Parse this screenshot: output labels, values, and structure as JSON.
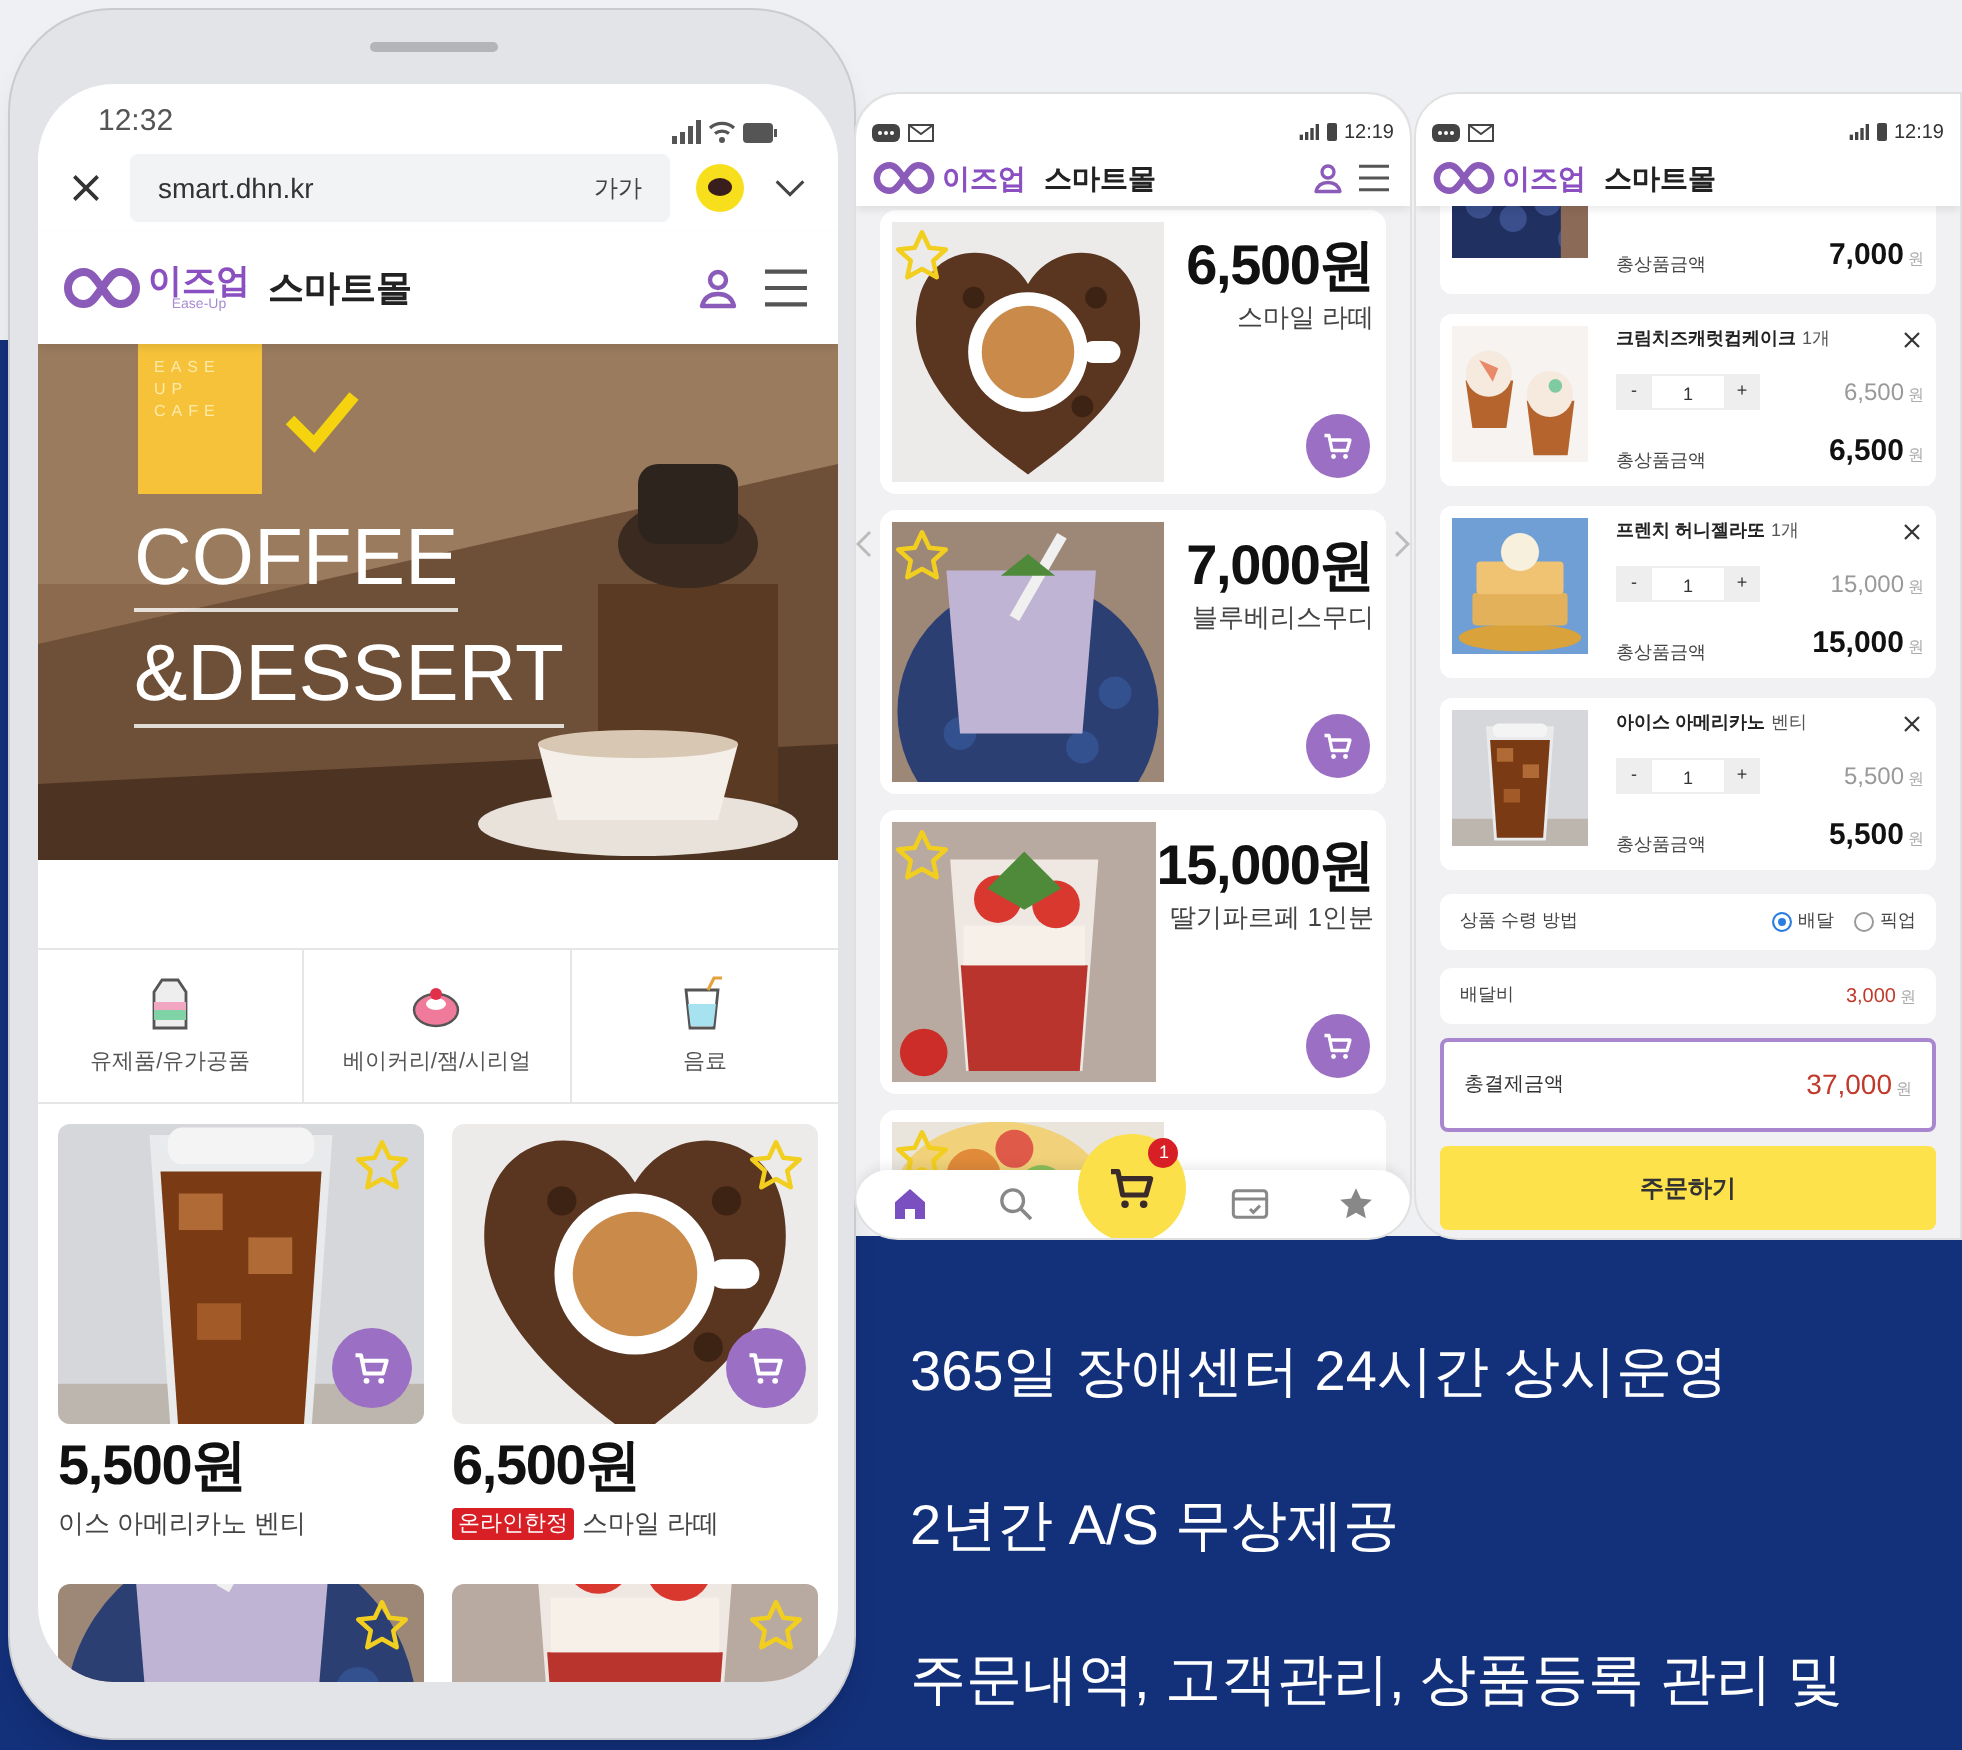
{
  "browser_phone": {
    "status_time": "12:32",
    "url": "smart.dhn.kr",
    "text_size_button": "가가",
    "brand": {
      "name": "이즈업",
      "sub": "Ease-Up",
      "mall": "스마트몰"
    },
    "banner": {
      "tag_lines": [
        "EASE",
        "UP",
        "CAFE"
      ],
      "title_lines": [
        "COFFEE",
        "&DESSERT"
      ]
    },
    "categories": [
      {
        "kind": "milk",
        "label": "유제품/유가공품"
      },
      {
        "kind": "cake",
        "label": "베이커리/잼/시리얼"
      },
      {
        "kind": "drink",
        "label": "음료"
      }
    ],
    "products": [
      {
        "price": "5,500원",
        "name": "이스 아메리카노 벤티"
      },
      {
        "price": "6,500원",
        "badge": "온라인한정",
        "name": "스마일 라떼"
      }
    ]
  },
  "list_phone": {
    "status_time": "12:19",
    "brand": {
      "name": "이즈업",
      "mall": "스마트몰"
    },
    "products": [
      {
        "price": "6,500원",
        "name": "스마일 라떼"
      },
      {
        "price": "7,000원",
        "name": "블루베리스무디"
      },
      {
        "price": "15,000원",
        "name": "딸기파르페 1인분"
      }
    ],
    "nav": [
      {
        "kind": "home",
        "selected": true
      },
      {
        "kind": "search",
        "selected": false
      },
      {
        "kind": "cart",
        "selected": false,
        "badge": "1"
      },
      {
        "kind": "card",
        "selected": false
      },
      {
        "kind": "star",
        "selected": false
      }
    ]
  },
  "cart_phone": {
    "status_time": "12:19",
    "brand": {
      "name": "이즈업",
      "mall": "스마트몰"
    },
    "items": [
      {
        "kind": "partial",
        "total_label": "총상품금액",
        "total": "7,000",
        "unit": "원"
      },
      {
        "kind": "full",
        "name": "크림치즈캐럿컵케이크",
        "count": "1개",
        "decrease": "-",
        "quantity": "1",
        "increase": "+",
        "price": "6,500",
        "price_unit": "원",
        "total_label": "총상품금액",
        "total": "6,500",
        "unit": "원"
      },
      {
        "kind": "full",
        "name": "프렌치 허니젤라또",
        "count": "1개",
        "decrease": "-",
        "quantity": "1",
        "increase": "+",
        "price": "15,000",
        "price_unit": "원",
        "total_label": "총상품금액",
        "total": "15,000",
        "unit": "원"
      },
      {
        "kind": "full",
        "name": "아이스 아메리카노",
        "count": "벤티",
        "decrease": "-",
        "quantity": "1",
        "increase": "+",
        "price": "5,500",
        "price_unit": "원",
        "total_label": "총상품금액",
        "total": "5,500",
        "unit": "원"
      }
    ],
    "receive": {
      "label": "상품 수령 방법",
      "options": [
        {
          "label": "배달",
          "selected": true
        },
        {
          "label": "픽업",
          "selected": false
        }
      ]
    },
    "delivery_fee": {
      "label": "배달비",
      "value": "3,000",
      "unit": "원"
    },
    "grand_total": {
      "label": "총결제금액",
      "value": "37,000",
      "unit": "원"
    },
    "order_button": "주문하기"
  },
  "features": [
    "365일 장애센터 24시간 상시운영",
    "2년간 A/S 무상제공",
    "주문내역, 고객관리, 상품등록 관리 및"
  ]
}
